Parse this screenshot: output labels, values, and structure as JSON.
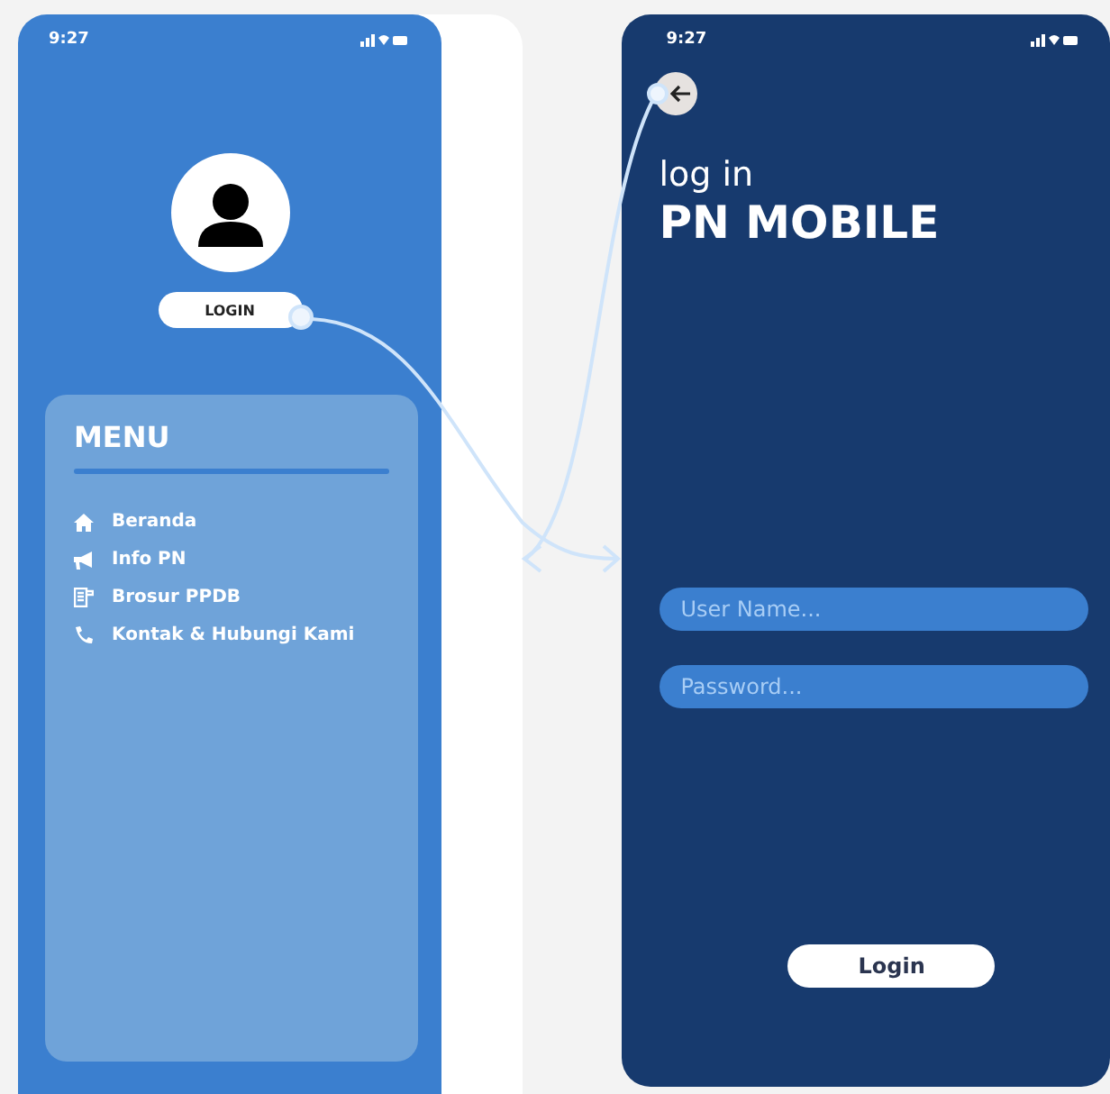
{
  "left_screen": {
    "status_time": "9:27",
    "login_button": "LOGIN",
    "menu": {
      "title": "MENU",
      "items": [
        {
          "label": "Beranda"
        },
        {
          "label": "Info PN"
        },
        {
          "label": "Brosur PPDB"
        },
        {
          "label": "Kontak & Hubungi Kami"
        }
      ]
    }
  },
  "right_screen": {
    "status_time": "9:27",
    "subtitle": "log in",
    "title": "PN MOBILE",
    "fields": [
      {
        "placeholder": "User Name..."
      },
      {
        "placeholder": "Password..."
      }
    ],
    "button": "Login"
  }
}
